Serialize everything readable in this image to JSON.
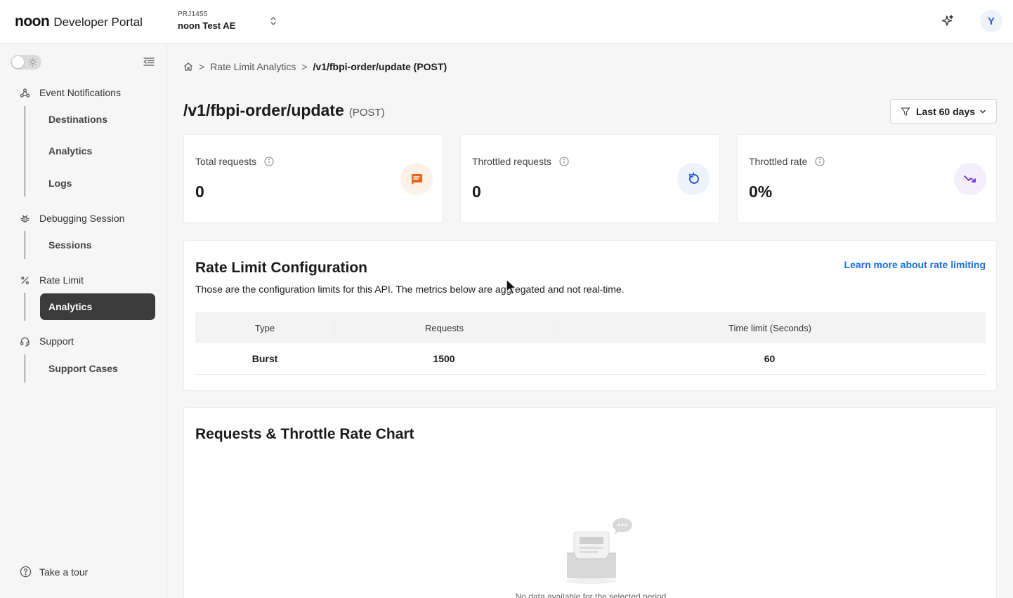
{
  "header": {
    "brand": "noon",
    "portal": "Developer Portal",
    "project_id": "PRJ1455",
    "project_name": "noon Test AE",
    "avatar_initial": "Y"
  },
  "sidebar": {
    "groups": [
      {
        "label": "Event Notifications",
        "icon": "webhook-icon",
        "items": [
          "Destinations",
          "Analytics",
          "Logs"
        ]
      },
      {
        "label": "Debugging Session",
        "icon": "bug-icon",
        "items": [
          "Sessions"
        ]
      },
      {
        "label": "Rate Limit",
        "icon": "percent-icon",
        "items": [
          "Analytics"
        ]
      },
      {
        "label": "Support",
        "icon": "headset-icon",
        "items": [
          "Support Cases"
        ]
      }
    ],
    "active_item": "Rate Limit / Analytics",
    "tour_label": "Take a tour"
  },
  "breadcrumb": {
    "parent": "Rate Limit Analytics",
    "separator": ">",
    "current": "/v1/fbpi-order/update (POST)"
  },
  "page": {
    "path": "/v1/fbpi-order/update",
    "method": "(POST)",
    "range_label": "Last 60 days"
  },
  "stats": [
    {
      "label": "Total requests",
      "value": "0",
      "icon": "message-icon",
      "color": "#e4671c",
      "bg": "#fdf1e8"
    },
    {
      "label": "Throttled requests",
      "value": "0",
      "icon": "refresh-icon",
      "color": "#2f5bd3",
      "bg": "#eef2fb"
    },
    {
      "label": "Throttled rate",
      "value": "0%",
      "icon": "trending-down-icon",
      "color": "#7a3fd6",
      "bg": "#f3eefb"
    }
  ],
  "config": {
    "title": "Rate Limit Configuration",
    "description": "Those are the configuration limits for this API. The metrics below are aggregated and not real-time.",
    "learn_more": "Learn more about rate limiting",
    "columns": [
      "Type",
      "Requests",
      "Time limit (Seconds)"
    ],
    "rows": [
      [
        "Burst",
        "1500",
        "60"
      ]
    ]
  },
  "chart": {
    "title": "Requests & Throttle Rate Chart",
    "empty_text": "No data available for the selected period"
  }
}
